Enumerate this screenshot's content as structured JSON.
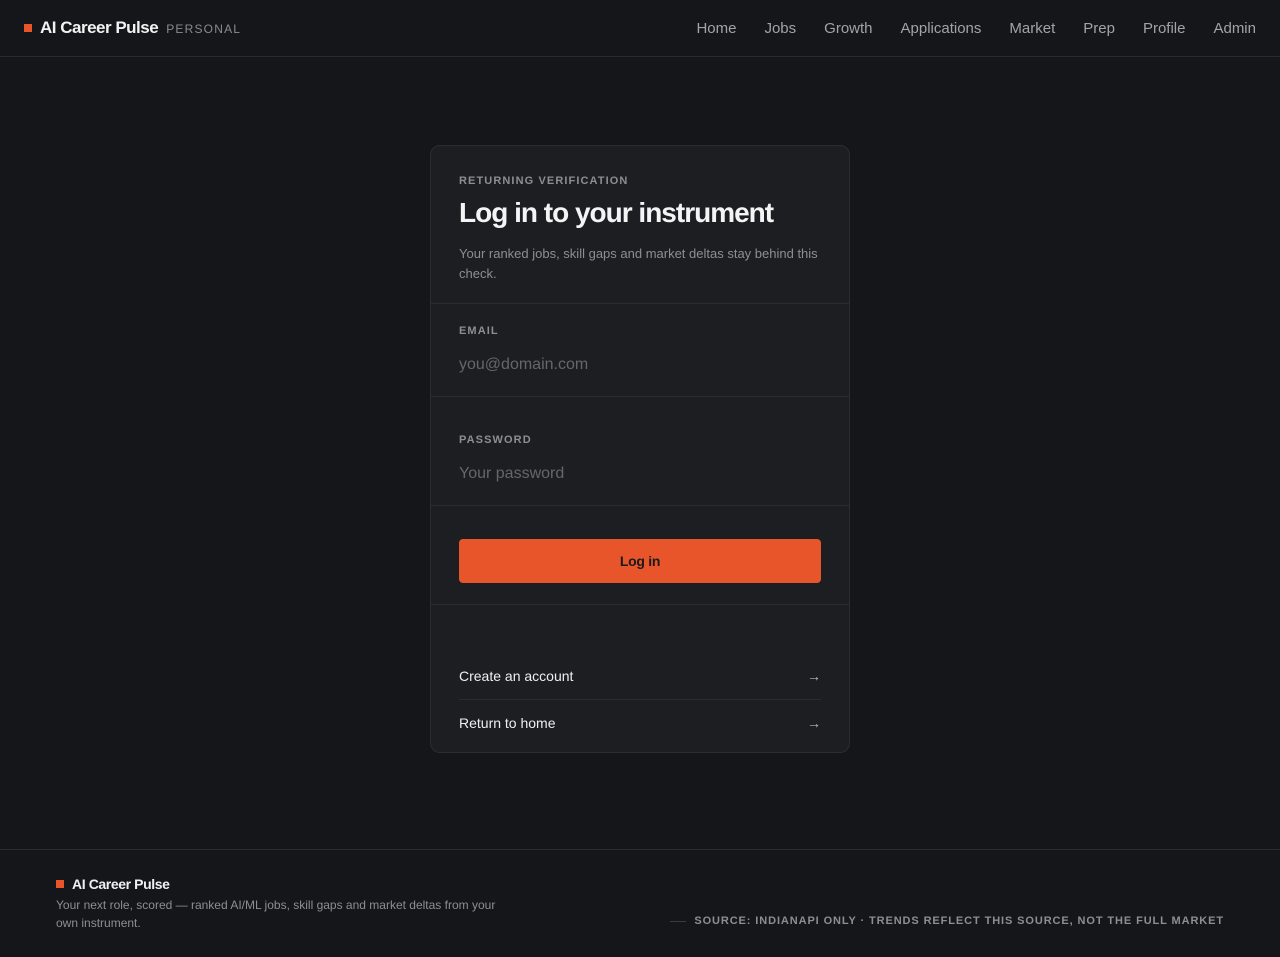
{
  "header": {
    "brand_name": "AI Career Pulse",
    "brand_tag": "PERSONAL",
    "nav": [
      {
        "label": "Home"
      },
      {
        "label": "Jobs"
      },
      {
        "label": "Growth"
      },
      {
        "label": "Applications"
      },
      {
        "label": "Market"
      },
      {
        "label": "Prep"
      },
      {
        "label": "Profile"
      },
      {
        "label": "Admin"
      }
    ]
  },
  "login": {
    "eyebrow": "RETURNING VERIFICATION",
    "title": "Log in to your instrument",
    "subtitle": "Your ranked jobs, skill gaps and market deltas stay behind this check.",
    "email": {
      "label": "EMAIL",
      "placeholder": "you@domain.com",
      "value": ""
    },
    "password": {
      "label": "PASSWORD",
      "placeholder": "Your password",
      "value": ""
    },
    "submit_label": "Log in",
    "links": [
      {
        "label": "Create an account",
        "icon": "arrow-right-icon",
        "glyph": "→"
      },
      {
        "label": "Return to home",
        "icon": "arrow-right-icon",
        "glyph": "→"
      }
    ]
  },
  "footer": {
    "brand_name": "AI Career Pulse",
    "description": "Your next role, scored — ranked AI/ML jobs, skill gaps and market deltas from your own instrument.",
    "source": "Source: IndianAPI only · trends reflect this source, not the full market"
  },
  "colors": {
    "accent": "#e8552a",
    "background": "#151619",
    "card": "#1d1e22",
    "border": "#2b2c31"
  }
}
